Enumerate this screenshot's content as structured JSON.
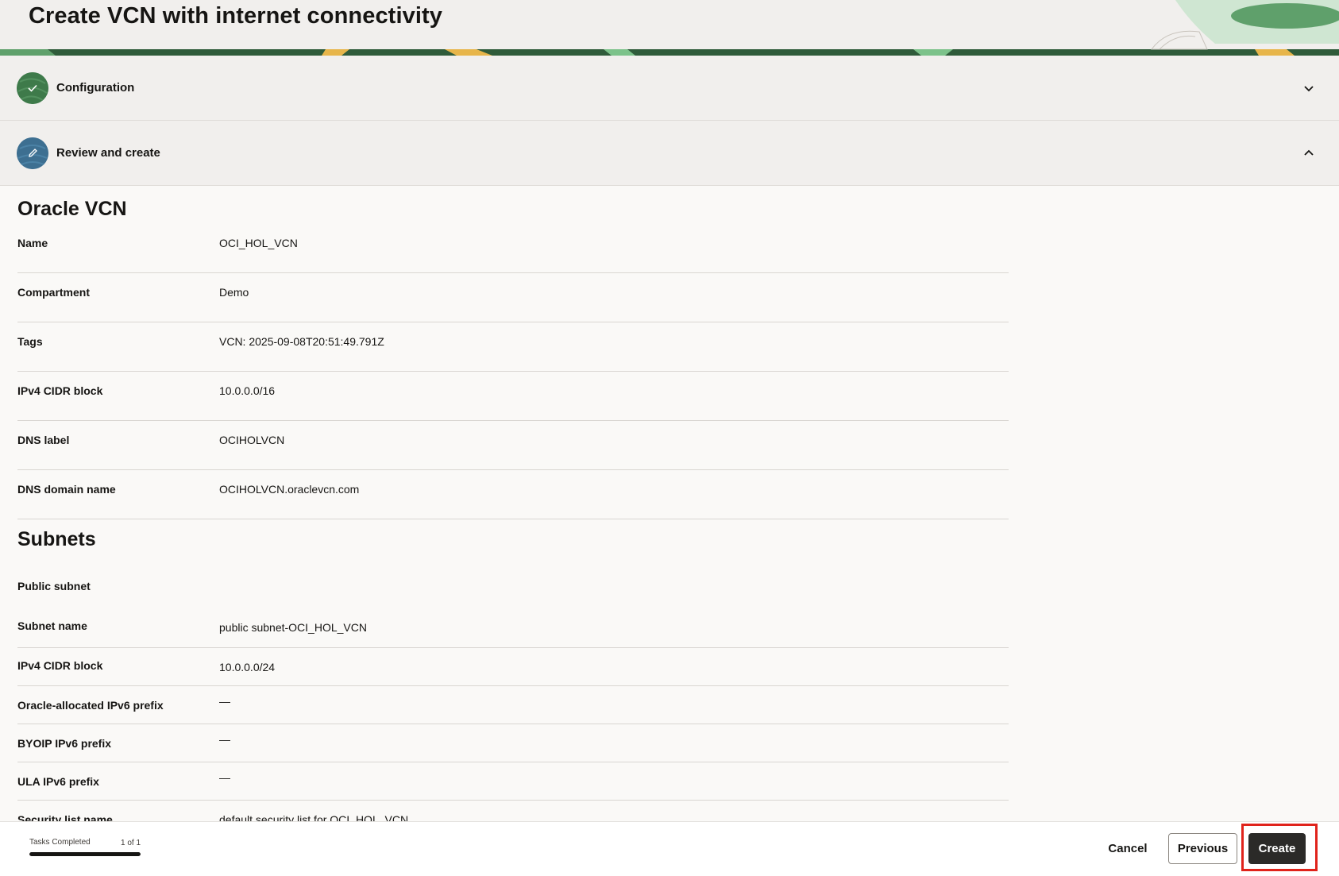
{
  "header": {
    "title": "Create VCN with internet connectivity"
  },
  "steps": [
    {
      "label": "Configuration",
      "status": "completed",
      "icon": "check-icon",
      "chevron": "chevron-down-icon"
    },
    {
      "label": "Review and create",
      "status": "current",
      "icon": "pencil-icon",
      "chevron": "chevron-up-icon"
    }
  ],
  "oracle_vcn": {
    "title": "Oracle VCN",
    "rows": [
      {
        "key": "Name",
        "value": "OCI_HOL_VCN"
      },
      {
        "key": "Compartment",
        "value": "Demo"
      },
      {
        "key": "Tags",
        "value": "VCN: 2025-09-08T20:51:49.791Z"
      },
      {
        "key": "IPv4 CIDR block",
        "value": "10.0.0.0/16"
      },
      {
        "key": "DNS label",
        "value": "OCIHOLVCN"
      },
      {
        "key": "DNS domain name",
        "value": "OCIHOLVCN.oraclevcn.com"
      }
    ]
  },
  "subnets": {
    "title": "Subnets",
    "public_subnet_label": "Public subnet",
    "rows": [
      {
        "key": "Subnet name",
        "value": "public subnet-OCI_HOL_VCN"
      },
      {
        "key": "IPv4 CIDR block",
        "value": "10.0.0.0/24"
      },
      {
        "key": "Oracle-allocated IPv6 prefix",
        "value": "—"
      },
      {
        "key": "BYOIP IPv6 prefix",
        "value": "—"
      },
      {
        "key": "ULA IPv6 prefix",
        "value": "—"
      },
      {
        "key": "Security list name",
        "value": "default security list for OCI_HOL_VCN"
      }
    ]
  },
  "footer": {
    "tasks_label": "Tasks Completed",
    "tasks_count": "1 of 1",
    "progress_fraction": 1.0,
    "cancel_label": "Cancel",
    "previous_label": "Previous",
    "create_label": "Create"
  },
  "colors": {
    "completed_badge": "#3e7a4a",
    "current_badge": "#3d6f91",
    "primary_button": "#2b2a28",
    "highlight": "#e0231b"
  }
}
